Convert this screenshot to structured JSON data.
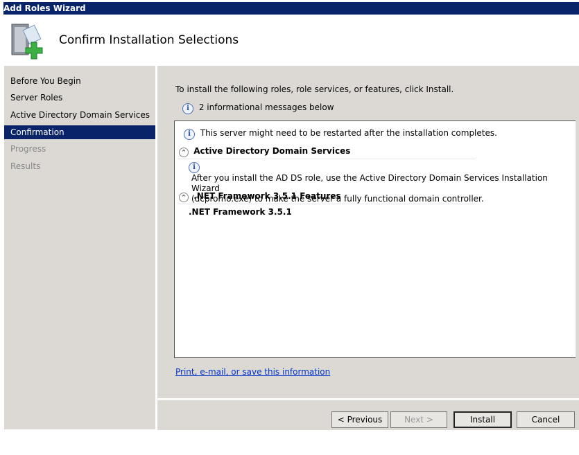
{
  "window": {
    "title": "Add Roles Wizard"
  },
  "header": {
    "title": "Confirm Installation Selections",
    "icon": "server-add-icon"
  },
  "sidebar": {
    "items": [
      {
        "label": "Before You Begin",
        "state": "normal"
      },
      {
        "label": "Server Roles",
        "state": "normal"
      },
      {
        "label": "Active Directory Domain Services",
        "state": "normal"
      },
      {
        "label": "Confirmation",
        "state": "selected"
      },
      {
        "label": "Progress",
        "state": "disabled"
      },
      {
        "label": "Results",
        "state": "disabled"
      }
    ]
  },
  "main": {
    "instruction": "To install the following roles, role services, or features, click Install.",
    "info_count": "2 informational messages below",
    "restart_note": "This server might need to be restarted after the installation completes.",
    "sections": [
      {
        "title": "Active Directory Domain Services",
        "message_line1": "After you install the AD DS role, use the Active Directory Domain Services Installation Wizard",
        "message_line2": "(dcpromo.exe) to make the server a fully functional domain controller."
      },
      {
        "title": ".NET Framework 3.5.1 Features",
        "item": ".NET Framework 3.5.1"
      }
    ],
    "link": "Print, e-mail, or save this information"
  },
  "buttons": {
    "previous": "< Previous",
    "next": "Next >",
    "install": "Install",
    "cancel": "Cancel"
  }
}
